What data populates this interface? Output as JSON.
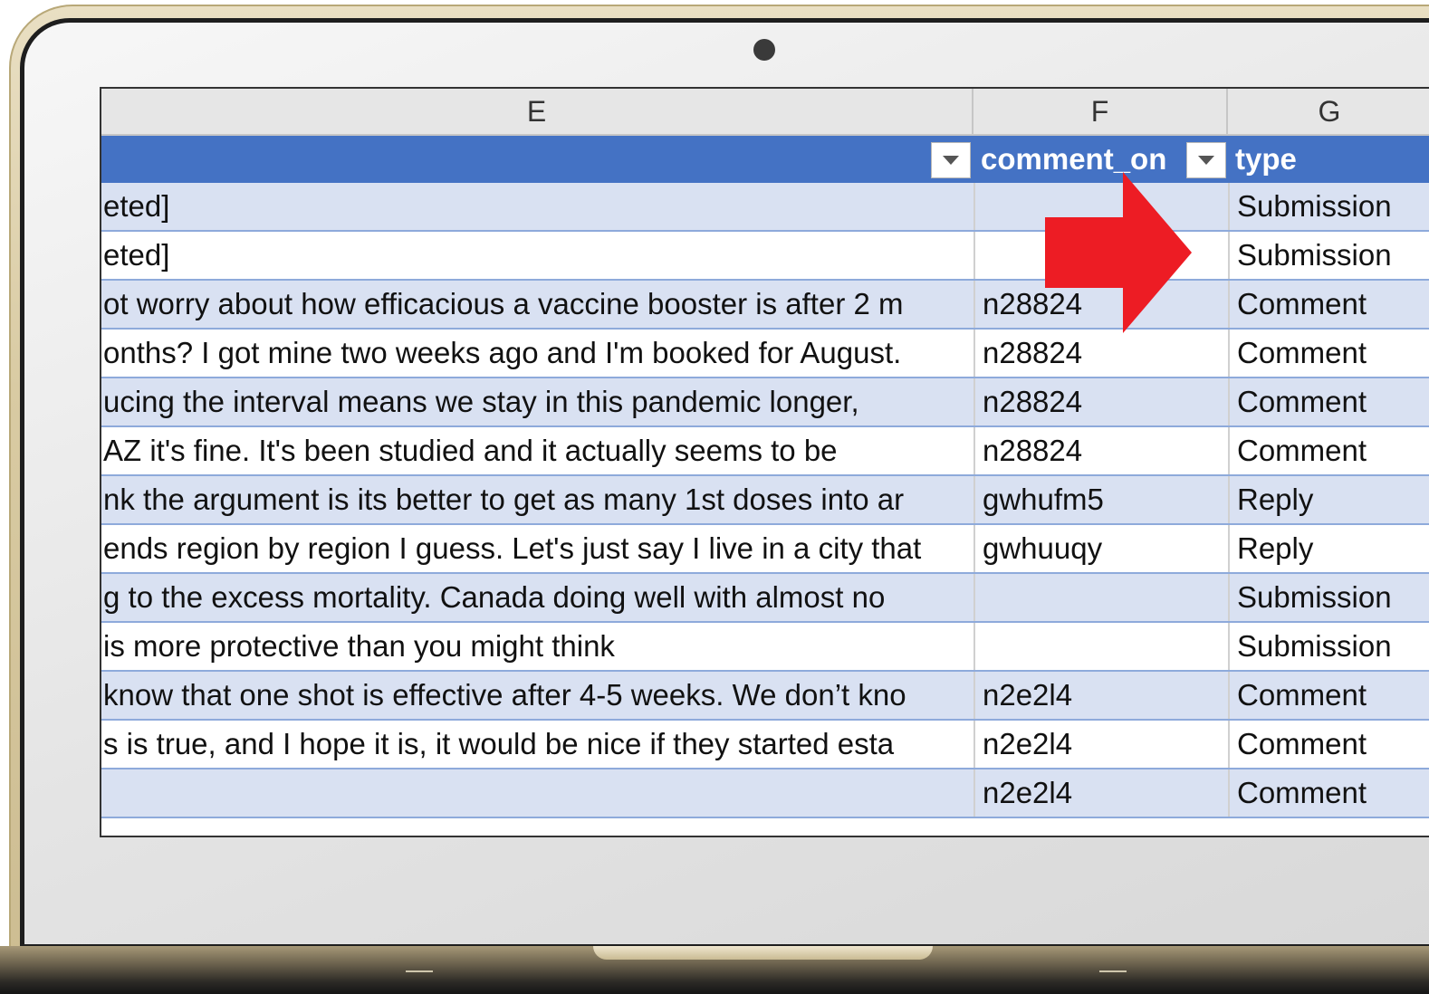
{
  "columns": {
    "e_letter": "E",
    "f_letter": "F",
    "g_letter": "G"
  },
  "table_header": {
    "comment_on": "comment_on",
    "type": "type"
  },
  "rows": [
    {
      "e": "eted]",
      "f": "",
      "g": "Submission"
    },
    {
      "e": "eted]",
      "f": "",
      "g": "Submission"
    },
    {
      "e": "ot worry about how efficacious a vaccine booster is after 2 m",
      "f": "n28824",
      "g": "Comment"
    },
    {
      "e": "onths?  I got mine two weeks ago and I'm booked for August.",
      "f": "n28824",
      "g": "Comment"
    },
    {
      "e": "ucing the interval means we stay in this pandemic longer,",
      "f": "n28824",
      "g": "Comment"
    },
    {
      "e": "AZ it's fine. It's been studied and it actually seems to be",
      "f": "n28824",
      "g": "Comment"
    },
    {
      "e": "nk the argument is its better to get as many 1st doses into ar",
      "f": "gwhufm5",
      "g": "Reply"
    },
    {
      "e": "ends region by region I guess. Let's just say I live in a city that",
      "f": "gwhuuqy",
      "g": "Reply"
    },
    {
      "e": "g to the excess mortality. Canada doing well with almost no",
      "f": "",
      "g": "Submission"
    },
    {
      "e": " is more protective than you might think",
      "f": "",
      "g": "Submission"
    },
    {
      "e": "know that one shot is effective after 4-5 weeks. We don’t kno",
      "f": "n2e2l4",
      "g": "Comment"
    },
    {
      "e": "s is true, and I hope it is, it would be nice if they started esta",
      "f": "n2e2l4",
      "g": "Comment"
    },
    {
      "e": "",
      "f": "n2e2l4",
      "g": "Comment"
    }
  ],
  "colors": {
    "header_blue": "#4472c4",
    "band_blue": "#d9e1f2",
    "arrow_red": "#ed1c24",
    "frame_gold": "#d9cba3"
  },
  "icons": [
    "filter-dropdown-icon",
    "red-arrow-annotation",
    "webcam-icon"
  ]
}
